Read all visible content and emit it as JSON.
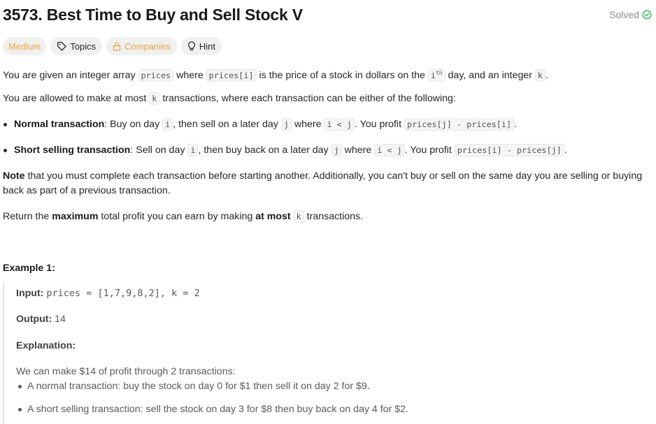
{
  "problem": {
    "title": "3573. Best Time to Buy and Sell Stock V",
    "status": "Solved"
  },
  "tags": {
    "difficulty": "Medium",
    "topics": "Topics",
    "companies": "Companies",
    "hint": "Hint"
  },
  "colors": {
    "medium": "#f0a530",
    "solved_check": "#2cbb5d"
  },
  "description": {
    "p1_a": "You are given an integer array ",
    "p1_code1": "prices",
    "p1_b": " where ",
    "p1_code2": "prices[i]",
    "p1_c": " is the price of a stock in dollars on the ",
    "p1_code3": "i",
    "p1_sup": "th",
    "p1_d": " day, and an integer ",
    "p1_code4": "k",
    "p1_e": ".",
    "p2_a": "You are allowed to make at most ",
    "p2_code": "k",
    "p2_b": " transactions, where each transaction can be either of the following:",
    "b1_bold": "Normal transaction",
    "b1_a": ": Buy on day ",
    "b1_code1": "i",
    "b1_b": ", then sell on a later day ",
    "b1_code2": "j",
    "b1_c": " where ",
    "b1_code3": "i < j",
    "b1_d": ". You profit ",
    "b1_code4": "prices[j] - prices[i]",
    "b1_e": ".",
    "b2_bold": "Short selling transaction",
    "b2_a": ": Sell on day ",
    "b2_code1": "i",
    "b2_b": ", then buy back on a later day ",
    "b2_code2": "j",
    "b2_c": " where ",
    "b2_code3": "i < j",
    "b2_d": ". You profit ",
    "b2_code4": "prices[i] - prices[j]",
    "b2_e": ".",
    "note_bold": "Note",
    "note_line1": " that you must complete each transaction before starting another. Additionally, you can't buy or sell on the same day you are selling or buying",
    "note_line2": "back as part of a previous transaction.",
    "ret_a": "Return the ",
    "ret_bold1": "maximum",
    "ret_b": " total profit you can earn by making ",
    "ret_bold2": "at most",
    "ret_code": "k",
    "ret_c": " transactions."
  },
  "example": {
    "title": "Example 1:",
    "input_label": "Input:",
    "input_value": "prices = [1,7,9,8,2], k = 2",
    "output_label": "Output:",
    "output_value": "14",
    "explanation_label": "Explanation:",
    "explanation_text": "We can make $14 of profit through 2 transactions:",
    "bullets": [
      "A normal transaction: buy the stock on day 0 for $1 then sell it on day 2 for $9.",
      "A short selling transaction: sell the stock on day 3 for $8 then buy back on day 4 for $2."
    ]
  }
}
